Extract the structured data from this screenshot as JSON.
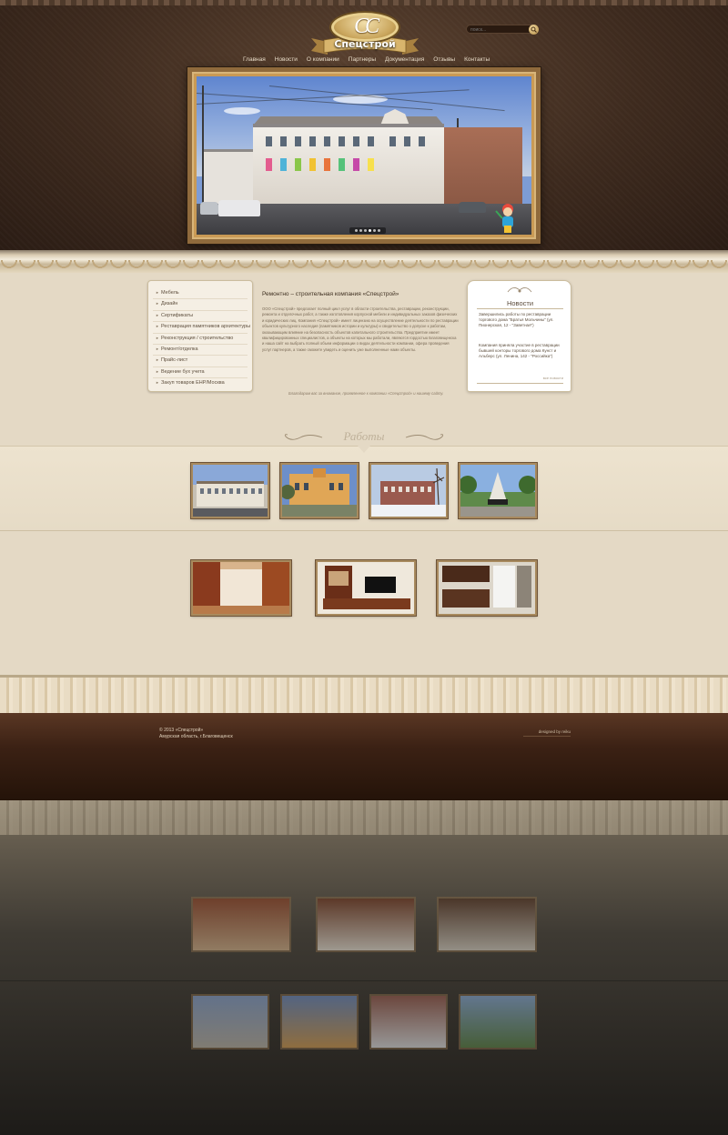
{
  "header": {
    "logo_letters": "CC",
    "logo_title": "Спецстрой",
    "search_placeholder": "поиск...",
    "nav": [
      "Главная",
      "Новости",
      "О компании",
      "Партнеры",
      "Документация",
      "Отзывы",
      "Контакты"
    ]
  },
  "slider": {
    "dots": 6,
    "active_dot": 3
  },
  "sidebar": {
    "items": [
      "Мебель",
      "Дизайн",
      "Сертификаты",
      "Реставрация памятников архитектуры",
      "Реконструкция / строительство",
      "Ремонт/отделка",
      "Прайс-лист",
      "Ведение бух учета",
      "Закуп товаров ЕНР/Москва"
    ]
  },
  "intro": {
    "title": "Ремонтно – строительная компания «Спецстрой»",
    "text": "ООО «Спецстрой» предлагает полный цикл услуг в области строительства, реставрации, реконструкции, ремонта и отделочных работ, а также изготовления корпусной мебели и индивидуальных заказов физических и юридических лиц. Компания «Спецстрой» имеет лицензию на осуществление деятельности по реставрации объектов культурного наследия (памятников истории и культуры) и свидетельство о допуске к работам, оказывающим влияние на безопасность объектов капитального строительства. Предприятие имеет квалифицированных специалистов, а объекты на которых мы работали, являются гордостью Благовещенска и наша сайт на выбрать полный объем информации о видах деятельности компании, офера проведения услуг партнеров, а также сможете увидеть и оценить уже выполненные нами объекты.",
    "note": "Благодарим вас за внимание, проявленное к компании «Спецстрой» и нашему сайту."
  },
  "news": {
    "title": "Новости",
    "items": [
      "Завершились работы по реставрации торгового дома \"Братья Мольчины\" (ул. Пионерская, 12 - \"Заветная\")",
      "Компания приняла участие в реставрации бывшей конторы торгового дома Кунст и Альберс (ул. Ленина, 142 - \"Российка\")"
    ],
    "all_label": "все новости"
  },
  "works": {
    "title": "Работы"
  },
  "footer": {
    "copyright": "© 2013 «Спецстрой»",
    "address": "Амурская область, г.Благовещенск",
    "designed_by": "designed by reiku"
  },
  "colors": {
    "header_bg": "#3d2a1e",
    "content_bg": "#e4d9c5",
    "frame_gold": "#a88a5e",
    "footer_bg": "#3b2114"
  },
  "icons": {
    "search": "magnifier-icon",
    "bullet": "triangle-right-icon",
    "ornament": "flourish-icon"
  }
}
